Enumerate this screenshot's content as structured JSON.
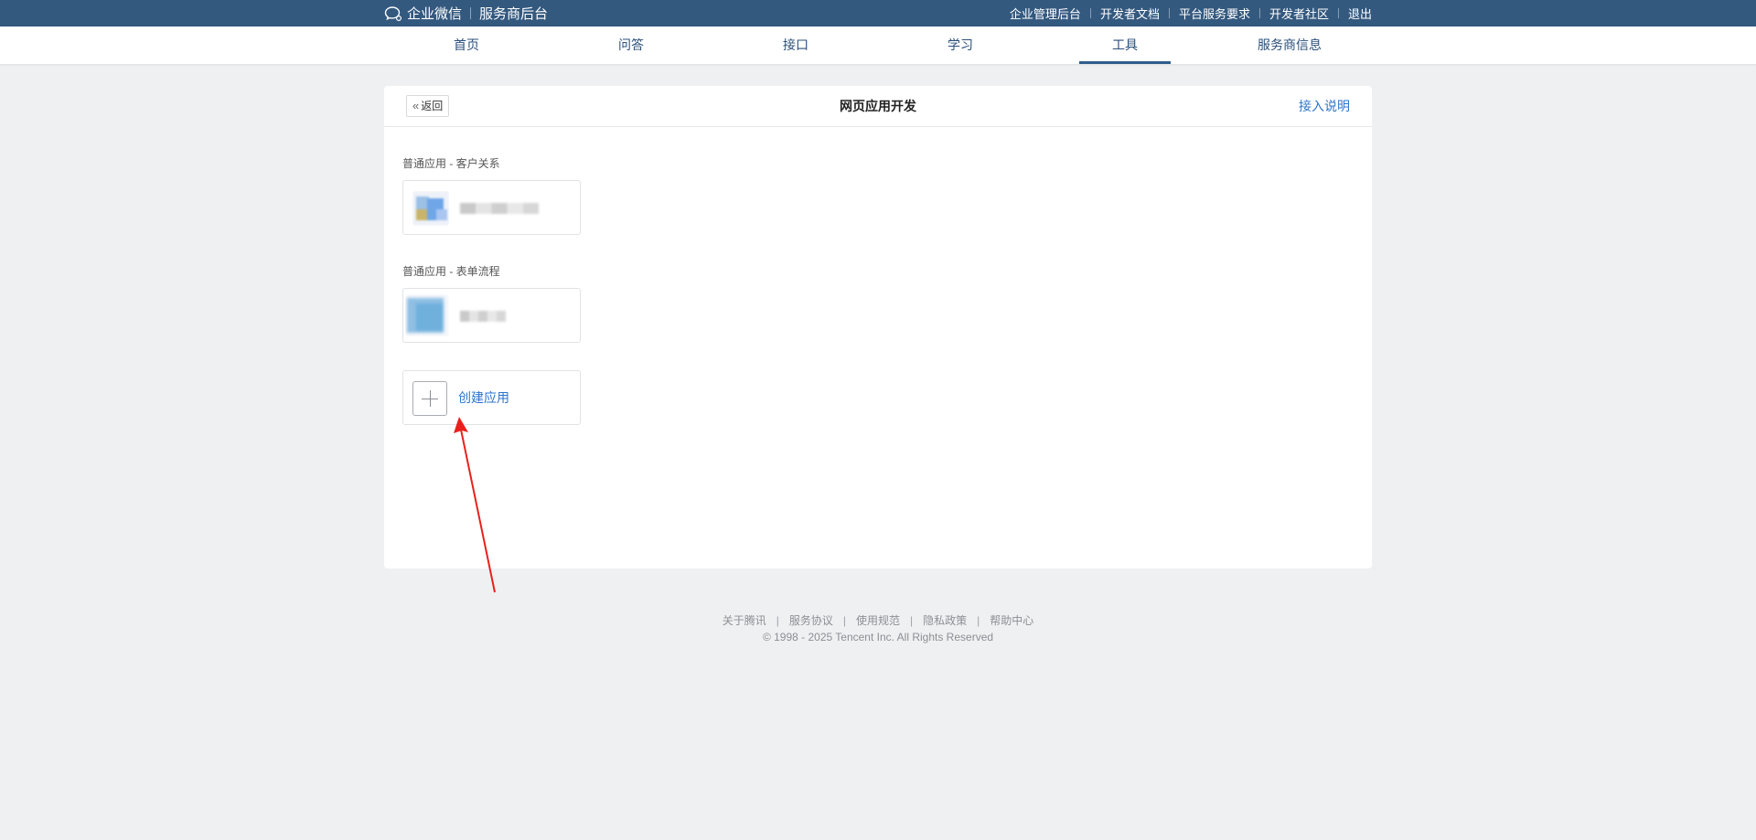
{
  "topbar": {
    "brand": "企业微信",
    "subtitle": "服务商后台",
    "links": [
      "企业管理后台",
      "开发者文档",
      "平台服务要求",
      "开发者社区",
      "退出"
    ]
  },
  "nav": {
    "items": [
      "首页",
      "问答",
      "接口",
      "学习",
      "工具",
      "服务商信息"
    ],
    "active": "工具"
  },
  "card": {
    "back_label": "返回",
    "title": "网页应用开发",
    "help_link": "接入说明",
    "sections": [
      {
        "label": "普通应用 - 客户关系"
      },
      {
        "label": "普通应用 - 表单流程"
      }
    ],
    "create_label": "创建应用"
  },
  "footer": {
    "links": [
      "关于腾讯",
      "服务协议",
      "使用规范",
      "隐私政策",
      "帮助中心"
    ],
    "copyright": "© 1998 - 2025 Tencent Inc. All Rights Reserved"
  },
  "colors": {
    "topbar_bg": "#34597f",
    "link_blue": "#2f74c7",
    "page_bg": "#eff0f2",
    "annotation_red": "#e8211c"
  }
}
